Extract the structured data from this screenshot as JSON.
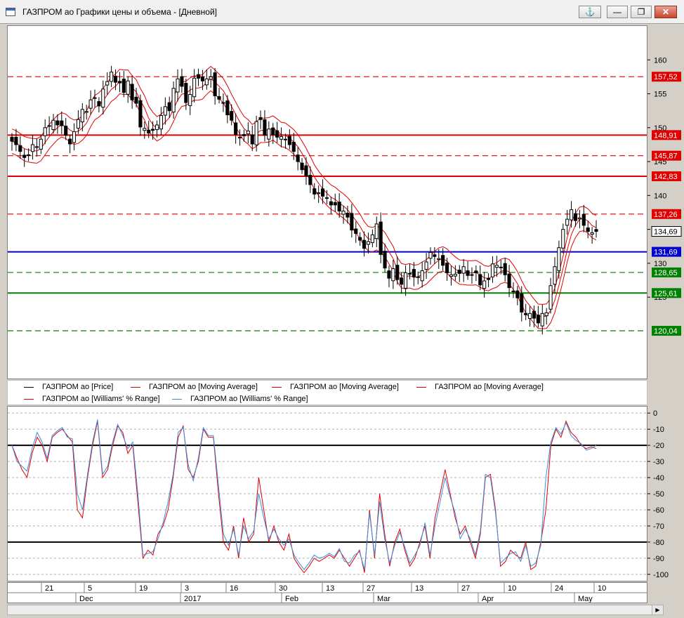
{
  "window": {
    "title": "ГАЗПРОМ ао Графики цены и объема - [Дневной]",
    "buttons": {
      "anchor": "⚓",
      "minimize": "—",
      "restore": "❐",
      "close": "✕"
    }
  },
  "colors": {
    "up_body": "#ffffff",
    "down_body": "#000000",
    "ma": "#e00000",
    "wr_red": "#e00000",
    "wr_blue": "#3a8ee0",
    "red_level": "#e00000",
    "blue_level": "#0000cc",
    "green_level": "#008000"
  },
  "chart_data": [
    {
      "type": "candlestick",
      "ylim": [
        113,
        165
      ],
      "y_ticks": [
        125,
        130,
        135,
        140,
        145,
        150,
        155,
        160
      ],
      "last_price_label": "134,69",
      "levels": [
        {
          "label": "157,52",
          "value": 157.52,
          "color": "red",
          "style": "dashed"
        },
        {
          "label": "148,91",
          "value": 148.91,
          "color": "red",
          "style": "solid"
        },
        {
          "label": "145,87",
          "value": 145.87,
          "color": "red",
          "style": "dashed"
        },
        {
          "label": "142,83",
          "value": 142.83,
          "color": "red",
          "style": "solid"
        },
        {
          "label": "137,26",
          "value": 137.26,
          "color": "red",
          "style": "dashed"
        },
        {
          "label": "131,69",
          "value": 131.69,
          "color": "blue",
          "style": "solid"
        },
        {
          "label": "128,65",
          "value": 128.65,
          "color": "green",
          "style": "dashed"
        },
        {
          "label": "125,61",
          "value": 125.61,
          "color": "green",
          "style": "solid"
        },
        {
          "label": "120,04",
          "value": 120.04,
          "color": "green",
          "style": "dashed"
        }
      ],
      "closes": [
        148,
        147.5,
        146.5,
        145.6,
        146,
        147.5,
        147.2,
        148.3,
        150,
        150.3,
        151.1,
        150.4,
        150.3,
        148.9,
        147.6,
        149.4,
        151.2,
        152.7,
        152.4,
        154.1,
        154.4,
        153.2,
        155.7,
        156.8,
        158.2,
        156.7,
        156.6,
        155.2,
        156.9,
        154.1,
        153.6,
        150.1,
        149.9,
        149.2,
        149.6,
        150.4,
        151.8,
        153.1,
        152.5,
        155.8,
        157.2,
        156.1,
        153.7,
        154.9,
        157.3,
        157.3,
        156.9,
        157.2,
        157.5,
        154.7,
        154.2,
        153.7,
        151.9,
        151.1,
        149,
        148.5,
        148.8,
        149.5,
        147.6,
        150.9,
        151.2,
        148.9,
        149.8,
        149,
        148.6,
        148.7,
        148.3,
        147.5,
        146.5,
        145,
        143.8,
        142.9,
        141.6,
        140.2,
        140.4,
        139.9,
        139.6,
        138.6,
        138.6,
        137.7,
        137.7,
        136.8,
        134.9,
        134.4,
        133.4,
        132.2,
        133.2,
        134.2,
        135.8,
        131.3,
        129.3,
        127.8,
        129.2,
        127.6,
        126.9,
        128.6,
        128.5,
        128,
        128,
        128.9,
        130.2,
        131.6,
        131,
        130.7,
        129.7,
        128.6,
        128.3,
        128.4,
        128.5,
        129.5,
        128.2,
        128.3,
        128.6,
        126.8,
        127.4,
        127.6,
        129.9,
        129.7,
        129.4,
        128.3,
        126.4,
        125.9,
        124.9,
        122.8,
        122.4,
        122.6,
        121.9,
        121.2,
        122.6,
        122.7,
        126.7,
        129.5,
        132.3,
        135,
        136.5,
        137.9,
        136.3,
        136.7,
        135.6,
        134.7,
        134.5,
        134.7
      ]
    },
    {
      "type": "line",
      "name_label": "Williams' % Range",
      "ylim": [
        -104,
        4
      ],
      "y_ticks": [
        0,
        -10,
        -20,
        -30,
        -40,
        -50,
        -60,
        -70,
        -80,
        -90,
        -100
      ],
      "threshold_lines": [
        -20,
        -80
      ],
      "series": [
        {
          "name": "ГАЗПРОМ ао [Williams' % Range]",
          "color": "red",
          "values": [
            -20,
            -28,
            -35,
            -40,
            -25,
            -15,
            -20,
            -30,
            -15,
            -12,
            -10,
            -14,
            -18,
            -60,
            -65,
            -40,
            -20,
            -5,
            -40,
            -35,
            -20,
            -8,
            -12,
            -25,
            -20,
            -55,
            -90,
            -85,
            -88,
            -75,
            -70,
            -60,
            -40,
            -15,
            -8,
            -35,
            -40,
            -30,
            -10,
            -15,
            -15,
            -50,
            -80,
            -85,
            -70,
            -90,
            -65,
            -80,
            -75,
            -40,
            -60,
            -80,
            -70,
            -80,
            -85,
            -75,
            -90,
            -95,
            -99,
            -95,
            -90,
            -92,
            -90,
            -88,
            -90,
            -85,
            -90,
            -95,
            -90,
            -85,
            -99,
            -60,
            -90,
            -50,
            -75,
            -95,
            -80,
            -72,
            -85,
            -95,
            -90,
            -80,
            -70,
            -90,
            -65,
            -50,
            -35,
            -50,
            -65,
            -75,
            -70,
            -80,
            -90,
            -75,
            -40,
            -38,
            -60,
            -95,
            -92,
            -85,
            -88,
            -90,
            -80,
            -97,
            -95,
            -80,
            -60,
            -20,
            -10,
            -15,
            -5,
            -12,
            -15,
            -20,
            -22,
            -21,
            -22
          ]
        },
        {
          "name": "ГАЗПРОМ ао [Williams' % Range]",
          "color": "blue",
          "values": [
            -20,
            -30,
            -33,
            -36,
            -22,
            -12,
            -18,
            -28,
            -14,
            -11,
            -9,
            -15,
            -16,
            -50,
            -60,
            -38,
            -18,
            -4,
            -38,
            -33,
            -18,
            -7,
            -14,
            -22,
            -18,
            -50,
            -88,
            -87,
            -86,
            -78,
            -68,
            -55,
            -38,
            -12,
            -9,
            -32,
            -42,
            -28,
            -9,
            -14,
            -14,
            -45,
            -75,
            -82,
            -72,
            -88,
            -70,
            -78,
            -73,
            -50,
            -65,
            -78,
            -72,
            -78,
            -82,
            -78,
            -88,
            -93,
            -97,
            -93,
            -88,
            -90,
            -89,
            -87,
            -89,
            -84,
            -92,
            -93,
            -88,
            -86,
            -97,
            -62,
            -88,
            -55,
            -78,
            -93,
            -82,
            -74,
            -83,
            -93,
            -88,
            -82,
            -68,
            -88,
            -70,
            -55,
            -40,
            -52,
            -62,
            -78,
            -72,
            -78,
            -88,
            -73,
            -38,
            -40,
            -62,
            -93,
            -90,
            -87,
            -86,
            -92,
            -82,
            -95,
            -93,
            -82,
            -40,
            -18,
            -9,
            -13,
            -6,
            -14,
            -17,
            -19,
            -23,
            -22,
            -20
          ]
        }
      ]
    }
  ],
  "legend": {
    "price": "ГАЗПРОМ ао [Price]",
    "ma1": "ГАЗПРОМ ао [Moving Average]",
    "ma2": "ГАЗПРОМ ао [Moving Average]",
    "ma3": "ГАЗПРОМ ао [Moving Average]",
    "wr1": "ГАЗПРОМ ао [Williams' % Range]",
    "wr2": "ГАЗПРОМ ао [Williams' % Range]"
  },
  "time_axis": {
    "days": [
      "21",
      "5",
      "19",
      "3",
      "16",
      "30",
      "13",
      "27",
      "13",
      "27",
      "10",
      "24",
      "10"
    ],
    "months": [
      "Dec",
      "2017",
      "Feb",
      "Mar",
      "Apr",
      "May"
    ]
  }
}
